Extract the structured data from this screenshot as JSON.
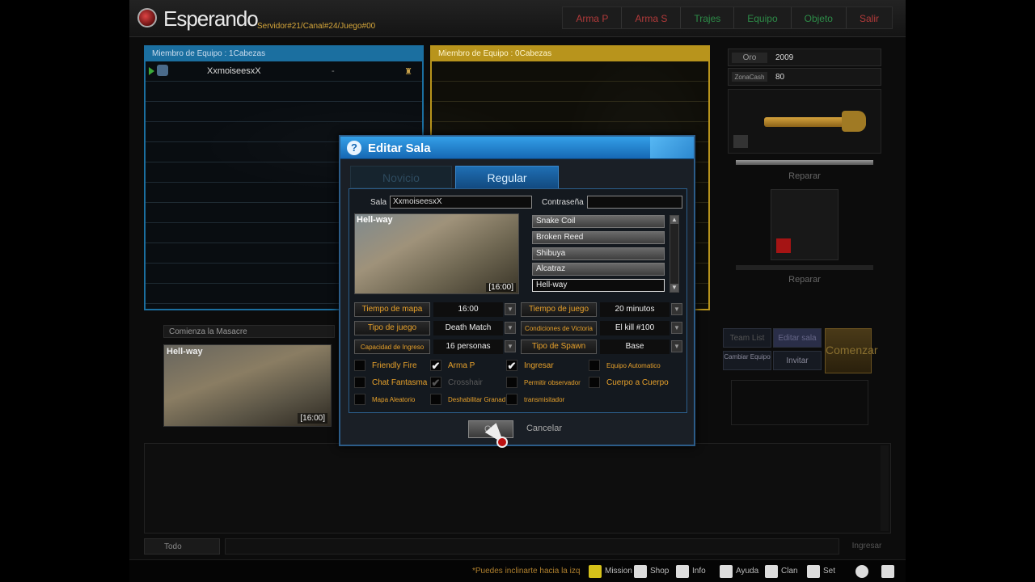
{
  "header": {
    "title": "Esperando",
    "server": "Servidor#21/Canal#24/Juego#00",
    "menu": [
      "Arma P",
      "Arma S",
      "Trajes",
      "Equipo",
      "Objeto",
      "Salir"
    ]
  },
  "teams": {
    "blue": {
      "header": "Miembro de Equipo : 1Cabezas",
      "player": "XxmoiseesxX",
      "player_extra": "-"
    },
    "yellow": {
      "header": "Miembro de Equipo : 0Cabezas"
    }
  },
  "stats": {
    "oro_label": "Oro",
    "oro_value": "2009",
    "cash_label": "ZonaCash",
    "cash_value": "80"
  },
  "repair_label": "Reparar",
  "repair_label2": "Reparar",
  "map_info": {
    "caption": "Comienza la Masacre",
    "name": "Hell-way",
    "time": "[16:00]"
  },
  "actions": {
    "team_list": "Team List",
    "edit_room": "Editar sala",
    "change_team": "Cambiar Equipo",
    "invite": "Invitar",
    "start": "Comenzar"
  },
  "chat": {
    "mode": "Todo",
    "send": "Ingresar"
  },
  "bottom": {
    "tip": "*Puedes inclinarte hacia la izq",
    "mission": "Mission",
    "shop": "Shop",
    "info": "Info",
    "help": "Ayuda",
    "clan": "Clan",
    "settings": "Set"
  },
  "dialog": {
    "title": "Editar Sala",
    "tabs": [
      "Novicio",
      "Regular"
    ],
    "sala_label": "Sala",
    "sala_value": "XxmoiseesxX",
    "password_label": "Contraseña",
    "password_value": "",
    "preview_name": "Hell-way",
    "preview_time": "[16:00]",
    "maps": [
      "Snake Coil",
      "Broken Reed",
      "Shibuya",
      "Alcatraz",
      "Hell-way"
    ],
    "selected_map": "Hell-way",
    "options": [
      {
        "label": "Tiempo de mapa",
        "value": "16:00"
      },
      {
        "label": "Tiempo de juego",
        "value": "20 minutos"
      },
      {
        "label": "Tipo de juego",
        "value": "Death Match"
      },
      {
        "label": "Condiciones de Victoria",
        "value": "El kill #100"
      },
      {
        "label": "Capacidad de Ingreso",
        "value": "16 personas"
      },
      {
        "label": "Tipo de Spawn",
        "value": "Base"
      }
    ],
    "checks": [
      {
        "label": "Friendly Fire",
        "checked": false
      },
      {
        "label": "Arma P",
        "checked": true
      },
      {
        "label": "Ingresar",
        "checked": true
      },
      {
        "label": "Equipo Automatico",
        "checked": false
      },
      {
        "label": "Chat Fantasma",
        "checked": false
      },
      {
        "label": "Crosshair",
        "checked": true
      },
      {
        "label": "Permitir observador",
        "checked": false
      },
      {
        "label": "Cuerpo a Cuerpo",
        "checked": false
      },
      {
        "label": "Mapa Aleatorio",
        "checked": false
      },
      {
        "label": "Deshabilitar Granad",
        "checked": false
      },
      {
        "label": "transmisitador",
        "checked": false
      }
    ],
    "ok_label": "OK",
    "cancel_label": "Cancelar"
  },
  "check_glyph": "✔"
}
